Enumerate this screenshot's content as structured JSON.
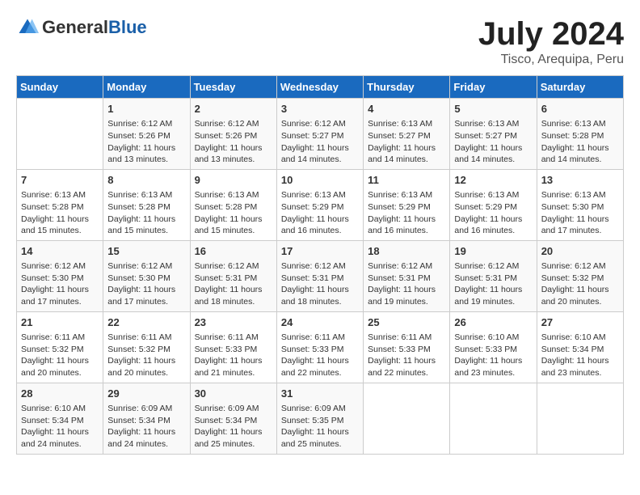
{
  "header": {
    "logo_general": "General",
    "logo_blue": "Blue",
    "title": "July 2024",
    "subtitle": "Tisco, Arequipa, Peru"
  },
  "calendar": {
    "days_of_week": [
      "Sunday",
      "Monday",
      "Tuesday",
      "Wednesday",
      "Thursday",
      "Friday",
      "Saturday"
    ],
    "weeks": [
      [
        {
          "day": "",
          "info": ""
        },
        {
          "day": "1",
          "info": "Sunrise: 6:12 AM\nSunset: 5:26 PM\nDaylight: 11 hours\nand 13 minutes."
        },
        {
          "day": "2",
          "info": "Sunrise: 6:12 AM\nSunset: 5:26 PM\nDaylight: 11 hours\nand 13 minutes."
        },
        {
          "day": "3",
          "info": "Sunrise: 6:12 AM\nSunset: 5:27 PM\nDaylight: 11 hours\nand 14 minutes."
        },
        {
          "day": "4",
          "info": "Sunrise: 6:13 AM\nSunset: 5:27 PM\nDaylight: 11 hours\nand 14 minutes."
        },
        {
          "day": "5",
          "info": "Sunrise: 6:13 AM\nSunset: 5:27 PM\nDaylight: 11 hours\nand 14 minutes."
        },
        {
          "day": "6",
          "info": "Sunrise: 6:13 AM\nSunset: 5:28 PM\nDaylight: 11 hours\nand 14 minutes."
        }
      ],
      [
        {
          "day": "7",
          "info": "Sunrise: 6:13 AM\nSunset: 5:28 PM\nDaylight: 11 hours\nand 15 minutes."
        },
        {
          "day": "8",
          "info": "Sunrise: 6:13 AM\nSunset: 5:28 PM\nDaylight: 11 hours\nand 15 minutes."
        },
        {
          "day": "9",
          "info": "Sunrise: 6:13 AM\nSunset: 5:28 PM\nDaylight: 11 hours\nand 15 minutes."
        },
        {
          "day": "10",
          "info": "Sunrise: 6:13 AM\nSunset: 5:29 PM\nDaylight: 11 hours\nand 16 minutes."
        },
        {
          "day": "11",
          "info": "Sunrise: 6:13 AM\nSunset: 5:29 PM\nDaylight: 11 hours\nand 16 minutes."
        },
        {
          "day": "12",
          "info": "Sunrise: 6:13 AM\nSunset: 5:29 PM\nDaylight: 11 hours\nand 16 minutes."
        },
        {
          "day": "13",
          "info": "Sunrise: 6:13 AM\nSunset: 5:30 PM\nDaylight: 11 hours\nand 17 minutes."
        }
      ],
      [
        {
          "day": "14",
          "info": "Sunrise: 6:12 AM\nSunset: 5:30 PM\nDaylight: 11 hours\nand 17 minutes."
        },
        {
          "day": "15",
          "info": "Sunrise: 6:12 AM\nSunset: 5:30 PM\nDaylight: 11 hours\nand 17 minutes."
        },
        {
          "day": "16",
          "info": "Sunrise: 6:12 AM\nSunset: 5:31 PM\nDaylight: 11 hours\nand 18 minutes."
        },
        {
          "day": "17",
          "info": "Sunrise: 6:12 AM\nSunset: 5:31 PM\nDaylight: 11 hours\nand 18 minutes."
        },
        {
          "day": "18",
          "info": "Sunrise: 6:12 AM\nSunset: 5:31 PM\nDaylight: 11 hours\nand 19 minutes."
        },
        {
          "day": "19",
          "info": "Sunrise: 6:12 AM\nSunset: 5:31 PM\nDaylight: 11 hours\nand 19 minutes."
        },
        {
          "day": "20",
          "info": "Sunrise: 6:12 AM\nSunset: 5:32 PM\nDaylight: 11 hours\nand 20 minutes."
        }
      ],
      [
        {
          "day": "21",
          "info": "Sunrise: 6:11 AM\nSunset: 5:32 PM\nDaylight: 11 hours\nand 20 minutes."
        },
        {
          "day": "22",
          "info": "Sunrise: 6:11 AM\nSunset: 5:32 PM\nDaylight: 11 hours\nand 20 minutes."
        },
        {
          "day": "23",
          "info": "Sunrise: 6:11 AM\nSunset: 5:33 PM\nDaylight: 11 hours\nand 21 minutes."
        },
        {
          "day": "24",
          "info": "Sunrise: 6:11 AM\nSunset: 5:33 PM\nDaylight: 11 hours\nand 22 minutes."
        },
        {
          "day": "25",
          "info": "Sunrise: 6:11 AM\nSunset: 5:33 PM\nDaylight: 11 hours\nand 22 minutes."
        },
        {
          "day": "26",
          "info": "Sunrise: 6:10 AM\nSunset: 5:33 PM\nDaylight: 11 hours\nand 23 minutes."
        },
        {
          "day": "27",
          "info": "Sunrise: 6:10 AM\nSunset: 5:34 PM\nDaylight: 11 hours\nand 23 minutes."
        }
      ],
      [
        {
          "day": "28",
          "info": "Sunrise: 6:10 AM\nSunset: 5:34 PM\nDaylight: 11 hours\nand 24 minutes."
        },
        {
          "day": "29",
          "info": "Sunrise: 6:09 AM\nSunset: 5:34 PM\nDaylight: 11 hours\nand 24 minutes."
        },
        {
          "day": "30",
          "info": "Sunrise: 6:09 AM\nSunset: 5:34 PM\nDaylight: 11 hours\nand 25 minutes."
        },
        {
          "day": "31",
          "info": "Sunrise: 6:09 AM\nSunset: 5:35 PM\nDaylight: 11 hours\nand 25 minutes."
        },
        {
          "day": "",
          "info": ""
        },
        {
          "day": "",
          "info": ""
        },
        {
          "day": "",
          "info": ""
        }
      ]
    ]
  }
}
